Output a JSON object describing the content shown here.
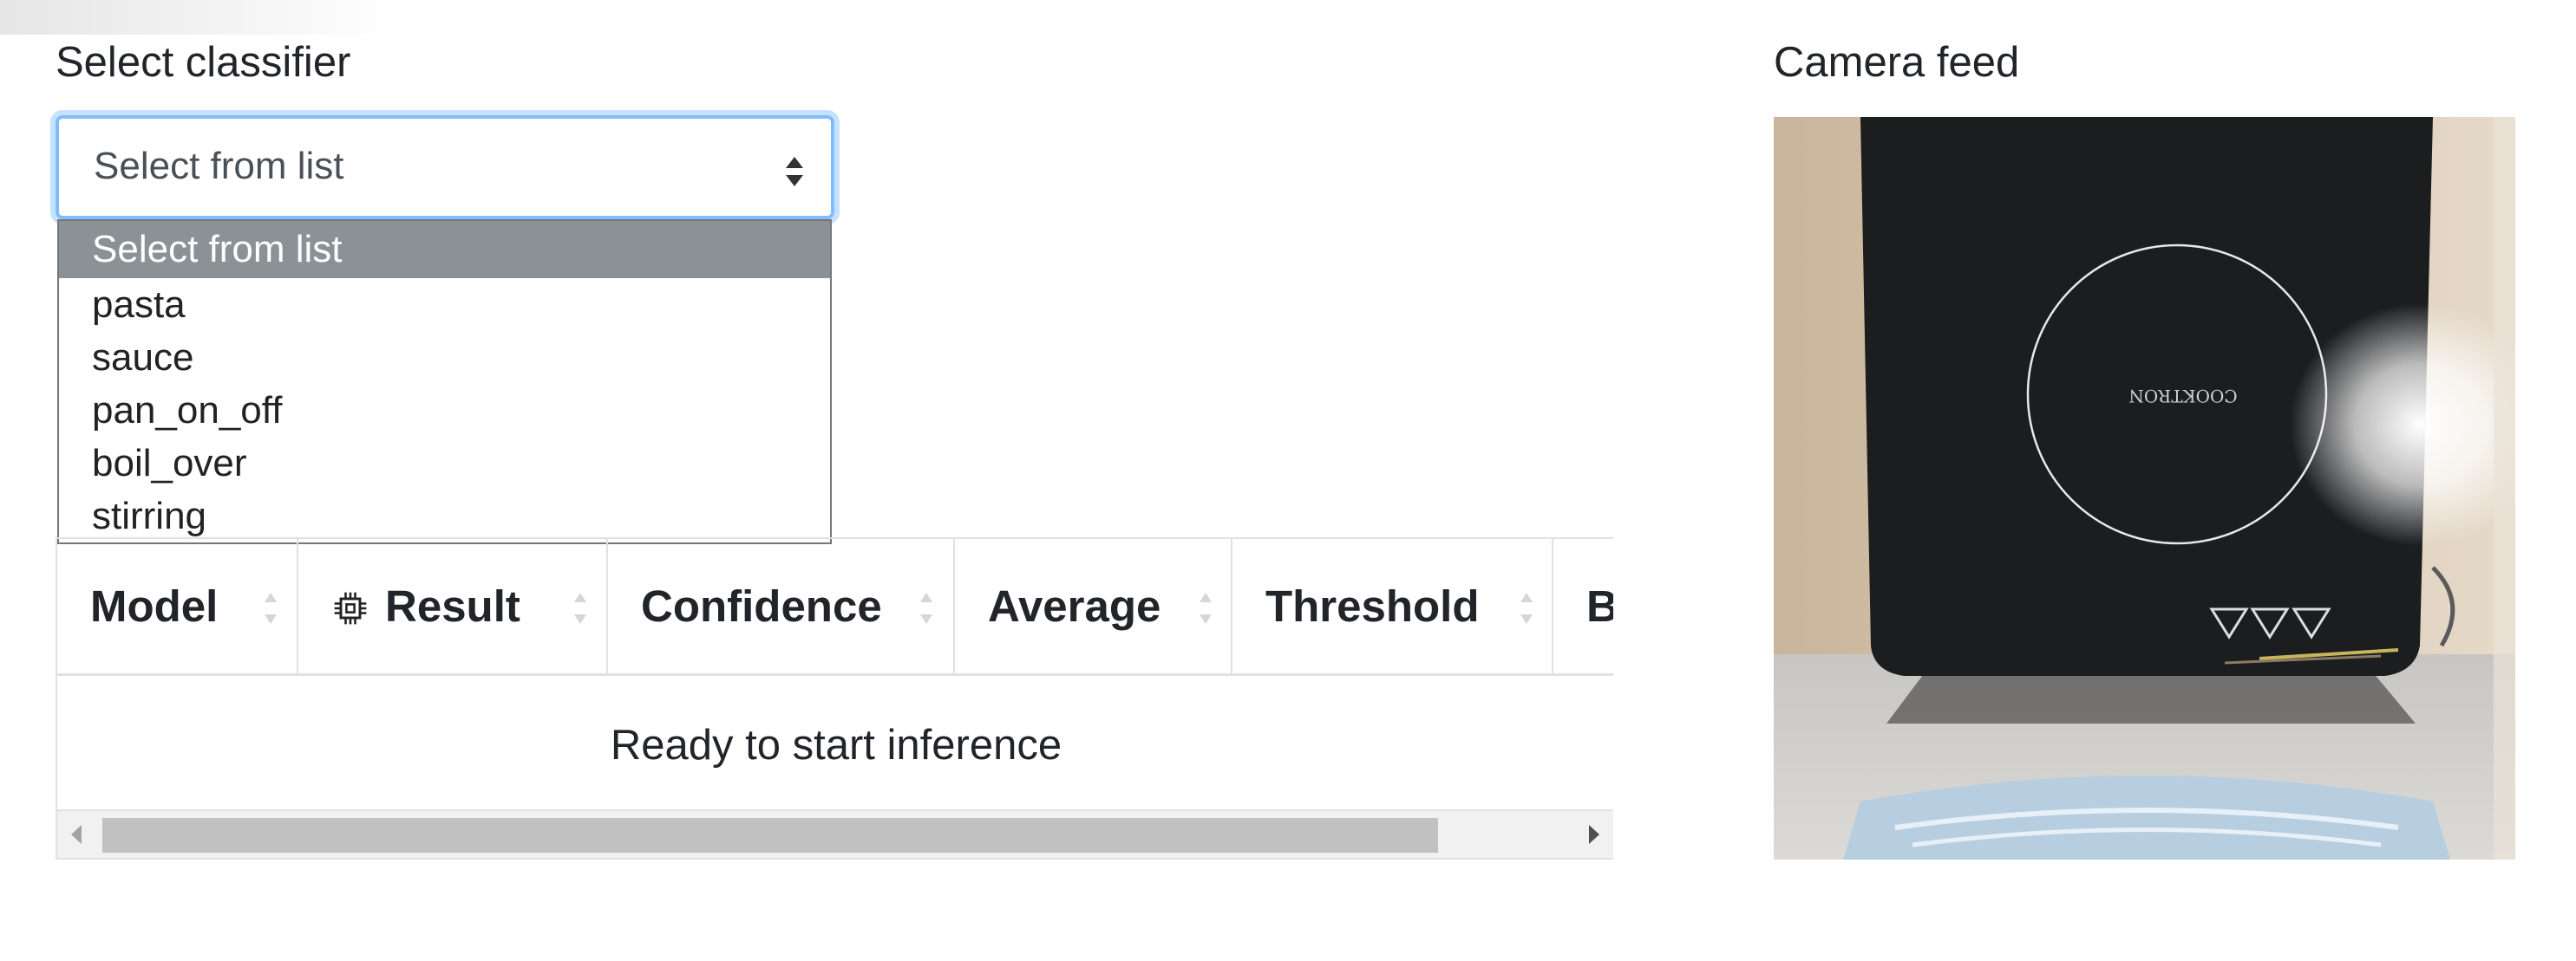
{
  "classifier": {
    "label": "Select classifier",
    "selected_value": "Select from list",
    "options": [
      "Select from list",
      "pasta",
      "sauce",
      "pan_on_off",
      "boil_over",
      "stirring"
    ]
  },
  "table": {
    "columns": [
      "Model",
      "Result",
      "Confidence",
      "Average",
      "Threshold",
      "B"
    ],
    "empty_message": "Ready to start inference"
  },
  "camera": {
    "label": "Camera feed",
    "device_text": "COOKTRON"
  },
  "colors": {
    "focus_border": "#80bdff",
    "selected_option_bg": "#8a9296",
    "table_border": "#dee2e6"
  }
}
